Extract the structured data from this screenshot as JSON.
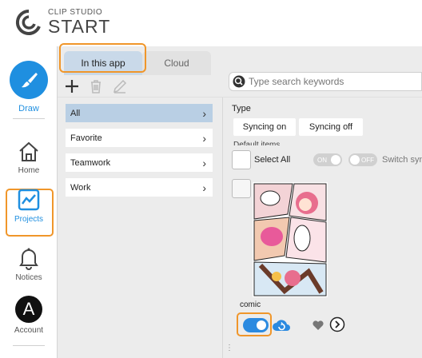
{
  "app": {
    "logo_top": "CLIP STUDIO",
    "logo_main": "START"
  },
  "sidebar": {
    "items": [
      {
        "label": "Draw",
        "icon": "brush-icon"
      },
      {
        "label": "Home",
        "icon": "house-icon"
      },
      {
        "label": "Projects",
        "icon": "chart-icon"
      },
      {
        "label": "Notices",
        "icon": "bell-icon"
      },
      {
        "label": "Account",
        "icon": "account-icon",
        "letter": "A"
      }
    ]
  },
  "tabs": [
    {
      "label": "In this app",
      "selected": true
    },
    {
      "label": "Cloud",
      "selected": false
    }
  ],
  "search": {
    "placeholder": "Type search keywords"
  },
  "categories": [
    {
      "label": "All",
      "selected": true
    },
    {
      "label": "Favorite",
      "selected": false
    },
    {
      "label": "Teamwork",
      "selected": false
    },
    {
      "label": "Work",
      "selected": false
    }
  ],
  "filters": {
    "type_label": "Type",
    "chips": [
      "Syncing on",
      "Syncing off"
    ],
    "default_label": "Default items"
  },
  "bulk": {
    "select_all": "Select All",
    "on_label": "ON",
    "off_label": "OFF",
    "switch_label": "Switch sync"
  },
  "card": {
    "name": "comic",
    "sync_enabled": true
  },
  "colors": {
    "accent": "#1f8fe0",
    "highlight": "#f0962a",
    "selected_tab": "#c9d9e9",
    "selected_category": "#b9cfe4"
  }
}
